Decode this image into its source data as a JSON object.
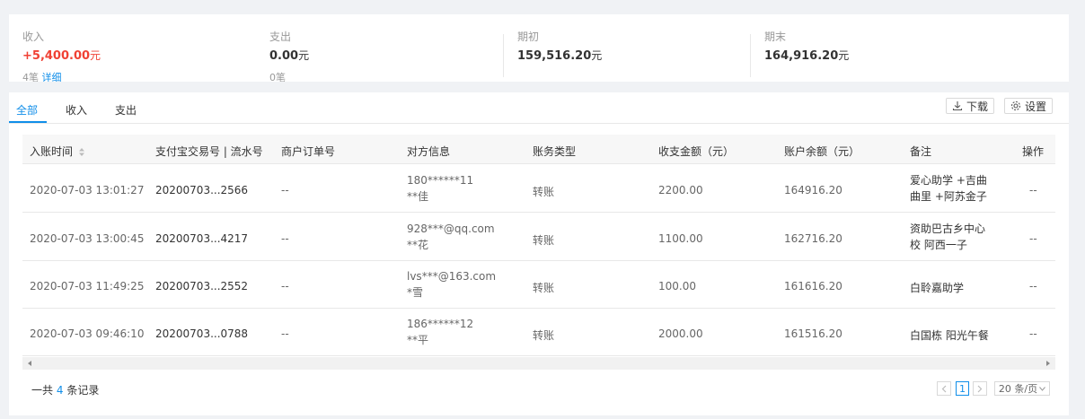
{
  "summary": {
    "income": {
      "label": "收入",
      "value": "+5,400.00",
      "unit": "元",
      "sub_count": "4笔",
      "sub_link": "详细"
    },
    "expense": {
      "label": "支出",
      "value": "0.00",
      "unit": "元",
      "sub_count": "0笔"
    },
    "opening": {
      "label": "期初",
      "value": "159,516.20",
      "unit": "元"
    },
    "closing": {
      "label": "期末",
      "value": "164,916.20",
      "unit": "元"
    }
  },
  "tabs": [
    {
      "label": "全部"
    },
    {
      "label": "收入"
    },
    {
      "label": "支出"
    }
  ],
  "toolbar": {
    "download_label": "下载",
    "settings_label": "设置"
  },
  "table": {
    "headers": [
      "入账时间",
      "支付宝交易号 | 流水号",
      "商户订单号",
      "对方信息",
      "账务类型",
      "收支金额（元）",
      "账户余额（元）",
      "备注",
      "操作"
    ],
    "rows": [
      {
        "time": "2020-07-03 13:01:27",
        "trade_no": "20200703...2566",
        "order_no": "--",
        "party_line1": "180******11",
        "party_line2": "**佳",
        "type": "转账",
        "amount": "2200.00",
        "balance": "164916.20",
        "memo_line1": "爱心助学 +吉曲",
        "memo_line2": "曲里 +阿苏金子",
        "action": "--"
      },
      {
        "time": "2020-07-03 13:00:45",
        "trade_no": "20200703...4217",
        "order_no": "--",
        "party_line1": "928***@qq.com",
        "party_line2": "**花",
        "type": "转账",
        "amount": "1100.00",
        "balance": "162716.20",
        "memo_line1": "资助巴古乡中心",
        "memo_line2": "校 阿西一子",
        "action": "--"
      },
      {
        "time": "2020-07-03 11:49:25",
        "trade_no": "20200703...2552",
        "order_no": "--",
        "party_line1": "lvs***@163.com",
        "party_line2": "*雪",
        "type": "转账",
        "amount": "100.00",
        "balance": "161616.20",
        "memo_line1": "白聆嘉助学",
        "memo_line2": "",
        "action": "--"
      },
      {
        "time": "2020-07-03 09:46:10",
        "trade_no": "20200703...0788",
        "order_no": "--",
        "party_line1": "186******12",
        "party_line2": "**平",
        "type": "转账",
        "amount": "2000.00",
        "balance": "161516.20",
        "memo_line1": "白国栋 阳光午餐",
        "memo_line2": "",
        "action": "--"
      }
    ]
  },
  "footer": {
    "total_prefix": "一共",
    "total_count": "4",
    "total_suffix": "条记录",
    "current_page": "1",
    "page_size": "20 条/页"
  },
  "colors": {
    "accent": "#108ee9",
    "income_red": "#f04134"
  }
}
